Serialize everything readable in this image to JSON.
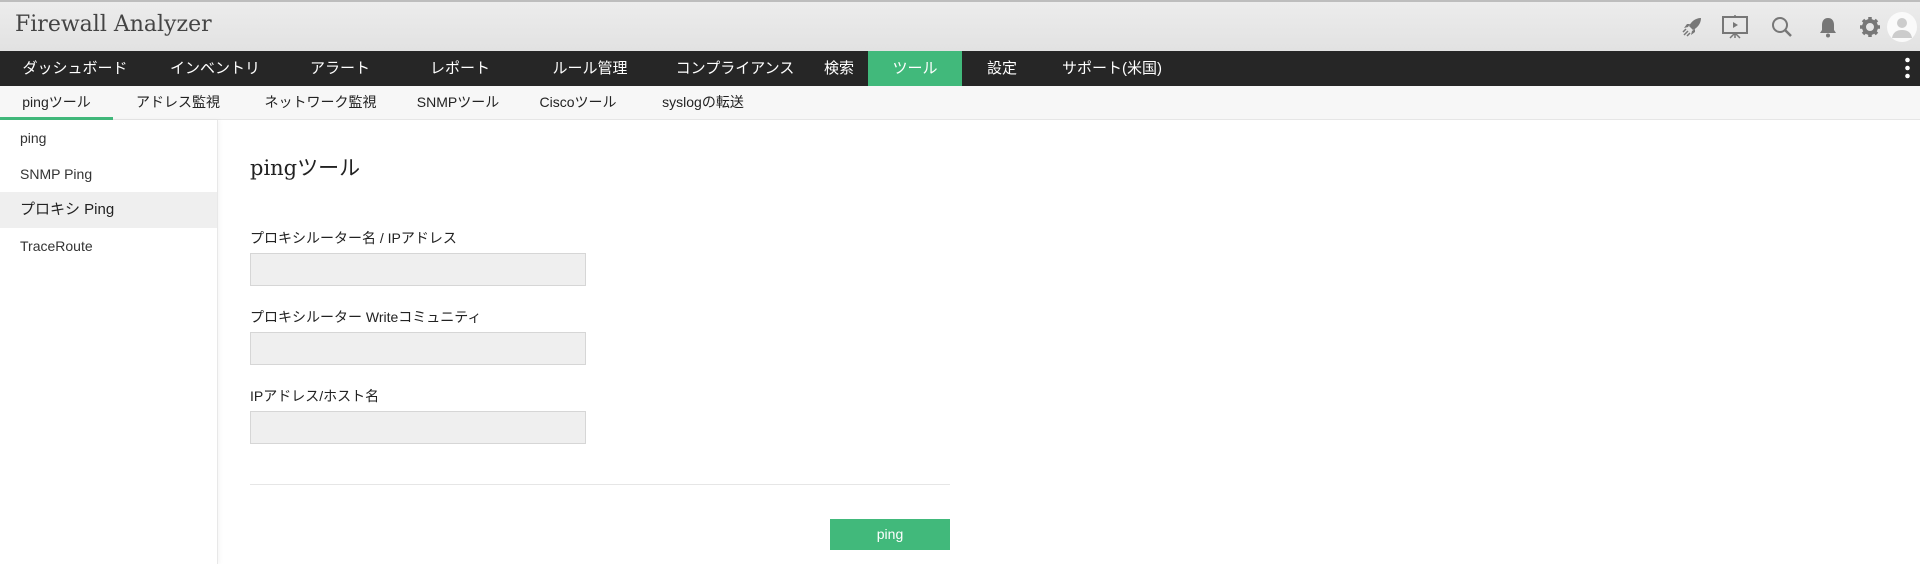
{
  "header": {
    "title": "Firewall Analyzer",
    "icons": [
      "rocket-icon",
      "presentation-icon",
      "search-icon",
      "bell-icon",
      "gear-icon",
      "user-avatar-icon"
    ]
  },
  "nav": {
    "items": [
      "ダッシュボード",
      "インベントリ",
      "アラート",
      "レポート",
      "ルール管理",
      "コンプライアンス",
      "検索",
      "ツール",
      "設定",
      "サポート(米国)"
    ],
    "active": "ツール"
  },
  "subnav": {
    "items": [
      "pingツール",
      "アドレス監視",
      "ネットワーク監視",
      "SNMPツール",
      "Ciscoツール",
      "syslogの転送"
    ],
    "active": "pingツール"
  },
  "sidebar": {
    "items": [
      "ping",
      "SNMP Ping",
      "プロキシ Ping",
      "TraceRoute"
    ],
    "active": "プロキシ Ping"
  },
  "main": {
    "title": "pingツール",
    "fields": [
      {
        "label": "プロキシルーター名 / IPアドレス",
        "value": ""
      },
      {
        "label": "プロキシルーター Writeコミュニティ",
        "value": ""
      },
      {
        "label": "IPアドレス/ホスト名",
        "value": ""
      }
    ],
    "button": "ping"
  },
  "colors": {
    "accent": "#41b97b",
    "nav_bg": "#262626"
  }
}
